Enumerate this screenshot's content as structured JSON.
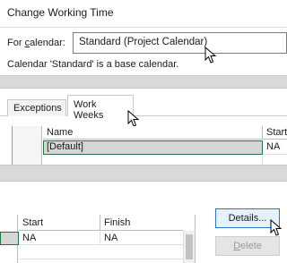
{
  "panel1": {
    "title": "Change Working Time",
    "calendar_label_pre": "For ",
    "calendar_label_underlined": "c",
    "calendar_label_post": "alendar:",
    "calendar_value": "Standard (Project Calendar)",
    "base_note": "Calendar 'Standard' is a base calendar."
  },
  "panel2": {
    "tabs": [
      {
        "label": "Exceptions"
      },
      {
        "label": "Work Weeks"
      }
    ],
    "columns": [
      "Name",
      "Start"
    ],
    "rows": [
      {
        "name": "[Default]",
        "start": "NA"
      }
    ]
  },
  "panel3": {
    "columns": [
      "Start",
      "Finish"
    ],
    "rows": [
      {
        "start": "NA",
        "finish": "NA"
      }
    ],
    "details_label": "Details...",
    "delete_pre": "",
    "delete_underlined": "D",
    "delete_post": "elete"
  },
  "icons": {
    "cursor": "mouse-pointer-icon"
  },
  "colors": {
    "selection_outline": "#217346",
    "focus_border": "#2a77c9"
  }
}
